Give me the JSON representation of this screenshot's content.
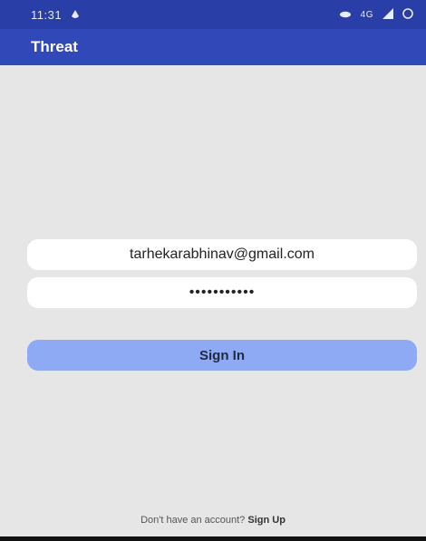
{
  "status_bar": {
    "time": "11:31",
    "network": "4G"
  },
  "app_bar": {
    "title": "Threat"
  },
  "form": {
    "email_value": "tarhekarabhinav@gmail.com",
    "password_mask": "•••••••••••",
    "sign_in_label": "Sign In"
  },
  "footer": {
    "prompt": "Don't have an account?",
    "sign_up_label": "Sign Up"
  },
  "colors": {
    "status_bar": "#2a3ea8",
    "app_bar": "#3048b8",
    "background": "#e6e6e6",
    "button": "#8faaf5"
  }
}
